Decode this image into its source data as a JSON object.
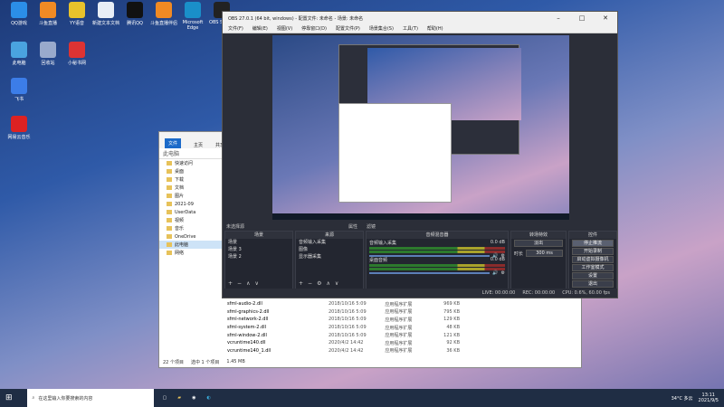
{
  "desktop_icons": [
    {
      "label": "QQ游戏",
      "color": "#2b8ee8"
    },
    {
      "label": "斗鱼直播",
      "color": "#f08a24"
    },
    {
      "label": "YY语音",
      "color": "#e8c22b"
    },
    {
      "label": "新建文本文档",
      "color": "#e8eef6"
    },
    {
      "label": "腾讯QQ",
      "color": "#111"
    },
    {
      "label": "斗鱼直播伴侣",
      "color": "#f08a24"
    },
    {
      "label": "Microsoft Edge",
      "color": "#1a8fc9"
    },
    {
      "label": "OBS Studio",
      "color": "#222"
    },
    {
      "label": "此电脑",
      "color": "#4aa3df"
    },
    {
      "label": "回收站",
      "color": "#9ac"
    },
    {
      "label": "小秘书网",
      "color": "#d33"
    },
    {
      "label": "飞书",
      "color": "#3c7de8"
    },
    {
      "label": "网易云音乐",
      "color": "#d22"
    }
  ],
  "explorer": {
    "ribbon": {
      "file": "文件",
      "home": "主页",
      "share": "共享"
    },
    "address": "此电脑",
    "nav": [
      {
        "label": "快速访问"
      },
      {
        "label": "桌面"
      },
      {
        "label": "下载"
      },
      {
        "label": "文档"
      },
      {
        "label": "图片"
      },
      {
        "label": "2021-09"
      },
      {
        "label": "UserData"
      },
      {
        "label": "视频"
      },
      {
        "label": "音乐"
      },
      {
        "label": "OneDrive"
      },
      {
        "label": "此电脑"
      },
      {
        "label": "网络"
      }
    ],
    "files": [
      {
        "name": "sfml-audio-2.dll",
        "date": "2018/10/16 5:09",
        "type": "应用程序扩展",
        "size": "969 KB"
      },
      {
        "name": "sfml-graphics-2.dll",
        "date": "2018/10/16 5:09",
        "type": "应用程序扩展",
        "size": "795 KB"
      },
      {
        "name": "sfml-network-2.dll",
        "date": "2018/10/16 5:09",
        "type": "应用程序扩展",
        "size": "129 KB"
      },
      {
        "name": "sfml-system-2.dll",
        "date": "2018/10/16 5:09",
        "type": "应用程序扩展",
        "size": "48 KB"
      },
      {
        "name": "sfml-window-2.dll",
        "date": "2018/10/16 5:09",
        "type": "应用程序扩展",
        "size": "121 KB"
      },
      {
        "name": "vcruntime140.dll",
        "date": "2020/4/2 14:42",
        "type": "应用程序扩展",
        "size": "92 KB"
      },
      {
        "name": "vcruntime140_1.dll",
        "date": "2020/4/2 14:42",
        "type": "应用程序扩展",
        "size": "36 KB"
      }
    ],
    "status": {
      "count": "22 个项目",
      "selected": "选中 1 个项目",
      "size": "1.45 MB"
    }
  },
  "obs": {
    "title": "OBS 27.0.1 (64 bit, windows) - 配置文件: 未命名 - 场景: 未命名",
    "menu": [
      "文件(F)",
      "编辑(E)",
      "视图(V)",
      "停靠窗口(D)",
      "配置文件(P)",
      "场景集合(S)",
      "工具(T)",
      "帮助(H)"
    ],
    "source_bar": {
      "label": "未选择源",
      "props": "属性",
      "filters": "滤镜"
    },
    "scenes": {
      "header": "场景",
      "items": [
        "场景",
        "场景 3",
        "场景 2"
      ]
    },
    "sources": {
      "header": "来源",
      "items": [
        "音频输入采集",
        "图像",
        "显示器采集"
      ]
    },
    "mixer": {
      "header": "音频混音器",
      "tracks": [
        {
          "name": "音频输入采集",
          "db": "0.0 dB"
        },
        {
          "name": "桌面音频",
          "db": "0.0 dB"
        }
      ]
    },
    "transitions": {
      "header": "转场特效",
      "type": "淡出",
      "duration_label": "时长",
      "duration": "300 ms"
    },
    "controls": {
      "header": "控件",
      "buttons": [
        "停止推流",
        "开始录制",
        "启动虚拟摄像机",
        "工作室模式",
        "设置",
        "退出"
      ]
    },
    "status": {
      "live": "LIVE: 00:00:00",
      "rec": "REC: 00:00:00",
      "cpu": "CPU: 0.6%, 60.00 fps"
    }
  },
  "taskbar": {
    "search_placeholder": "在这里输入你要搜索的内容",
    "weather": "34°C 多云",
    "time": "13:11",
    "date": "2021/9/5"
  }
}
